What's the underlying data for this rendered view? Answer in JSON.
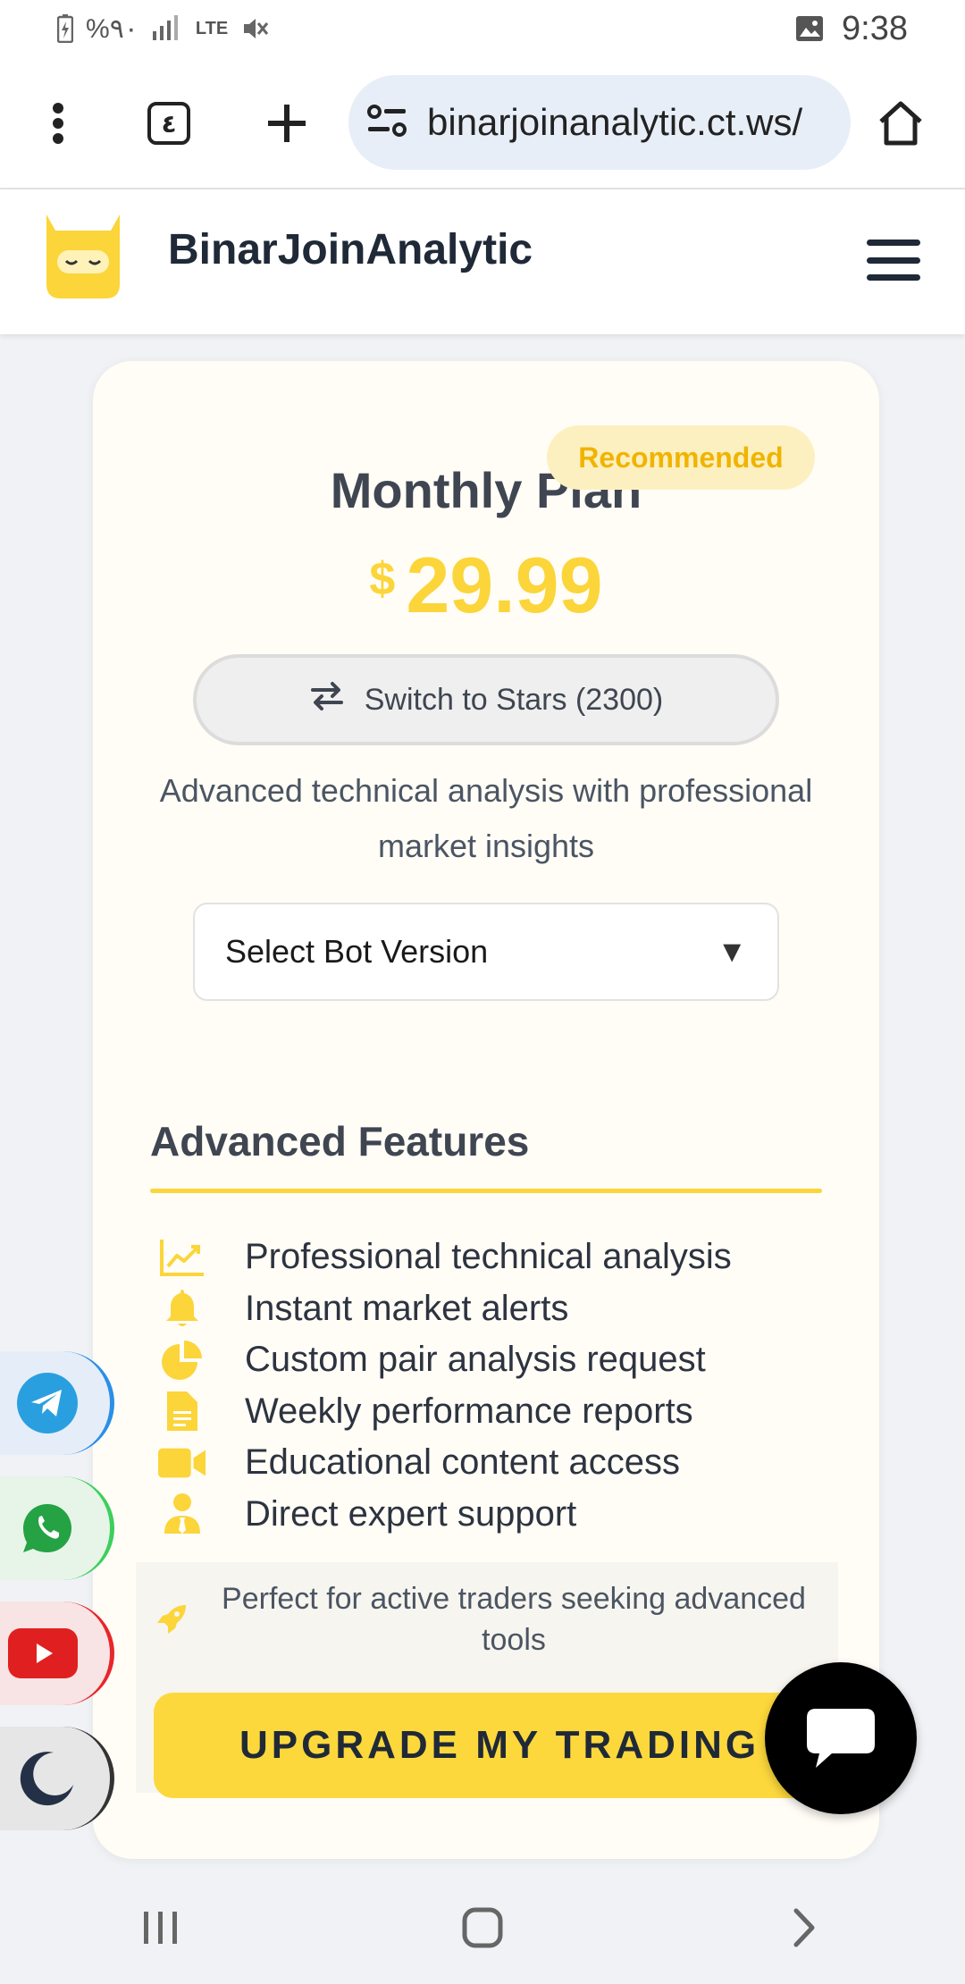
{
  "status_bar": {
    "left_text": "%٩٠",
    "network": "LTE",
    "time": "9:38"
  },
  "browser": {
    "tab_count": "٤",
    "url": "binarjoinanalytic.ct.ws/",
    "icons": [
      "more-vert-icon",
      "tabs-icon",
      "new-tab-icon",
      "site-settings-icon",
      "home-icon"
    ]
  },
  "header": {
    "brand": "BinarJoinAnalytic",
    "logo_color": "#FBD53A"
  },
  "plan": {
    "badge": "Recommended",
    "title": "Monthly Plan",
    "currency": "$",
    "price": "29.99",
    "switch_label": "Switch to Stars (2300)",
    "description": "Advanced technical analysis with professional market insights",
    "select_label": "Select Bot Version",
    "select_arrow": "▼"
  },
  "features": {
    "title": "Advanced Features",
    "items": [
      {
        "icon": "chart-line-icon",
        "text": "Professional technical analysis"
      },
      {
        "icon": "bell-icon",
        "text": "Instant market alerts"
      },
      {
        "icon": "pie-chart-icon",
        "text": "Custom pair analysis request"
      },
      {
        "icon": "document-icon",
        "text": "Weekly performance reports"
      },
      {
        "icon": "video-icon",
        "text": "Educational content access"
      },
      {
        "icon": "user-tie-icon",
        "text": "Direct expert support"
      }
    ]
  },
  "note": {
    "icon": "rocket-icon",
    "text": "Perfect for active traders seeking advanced tools"
  },
  "cta": {
    "label": "UPGRADE MY TRADING"
  },
  "side_buttons": [
    "telegram-icon",
    "whatsapp-icon",
    "youtube-icon",
    "moon-icon"
  ],
  "colors": {
    "accent": "#FBD53A",
    "badge_bg": "#FDF0C0",
    "badge_text": "#F0B400",
    "telegram": "#2A8FE8",
    "whatsapp": "#3CCF5C",
    "youtube": "#E8262B"
  }
}
